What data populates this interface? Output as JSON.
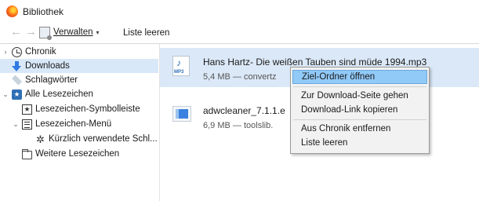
{
  "window": {
    "title": "Bibliothek"
  },
  "toolbar": {
    "back": "←",
    "forward": "→",
    "manage_label": "Verwalten",
    "manage_caret": "▾",
    "clear_label": "Liste leeren"
  },
  "sidebar": {
    "items": [
      {
        "label": "Chronik",
        "twisty": "›",
        "icon": "clock-icon"
      },
      {
        "label": "Downloads",
        "twisty": "",
        "icon": "download-icon",
        "selected": true
      },
      {
        "label": "Schlagwörter",
        "twisty": "",
        "icon": "tag-icon"
      },
      {
        "label": "Alle Lesezeichen",
        "twisty": "⌄",
        "icon": "bookmarks-icon"
      },
      {
        "label": "Lesezeichen-Symbolleiste",
        "twisty": "",
        "icon": "toolbar-folder-icon"
      },
      {
        "label": "Lesezeichen-Menü",
        "twisty": "⌄",
        "icon": "menu-folder-icon"
      },
      {
        "label": "Kürzlich verwendete Schl...",
        "twisty": "",
        "icon": "gear-icon"
      },
      {
        "label": "Weitere Lesezeichen",
        "twisty": "",
        "icon": "folder-icon"
      }
    ]
  },
  "downloads": [
    {
      "name": "Hans Hartz- Die weißen Tauben sind müde 1994.mp3",
      "status": "5,4 MB — convertz",
      "icon_label": "MP3",
      "icon_glyph": "♪",
      "selected": true
    },
    {
      "name": "adwcleaner_7.1.1.e",
      "status": "6,9 MB — toolslib.",
      "selected": false
    }
  ],
  "context_menu": {
    "items": [
      {
        "label": "Ziel-Ordner öffnen",
        "highlighted": true
      },
      {
        "label": "Zur Download-Seite gehen"
      },
      {
        "label": "Download-Link kopieren"
      },
      {
        "label": "Aus Chronik entfernen"
      },
      {
        "label": "Liste leeren"
      }
    ]
  },
  "colors": {
    "selection": "#dbe8f7",
    "menu_highlight": "#91c9f7",
    "accent": "#2f7ae5"
  }
}
